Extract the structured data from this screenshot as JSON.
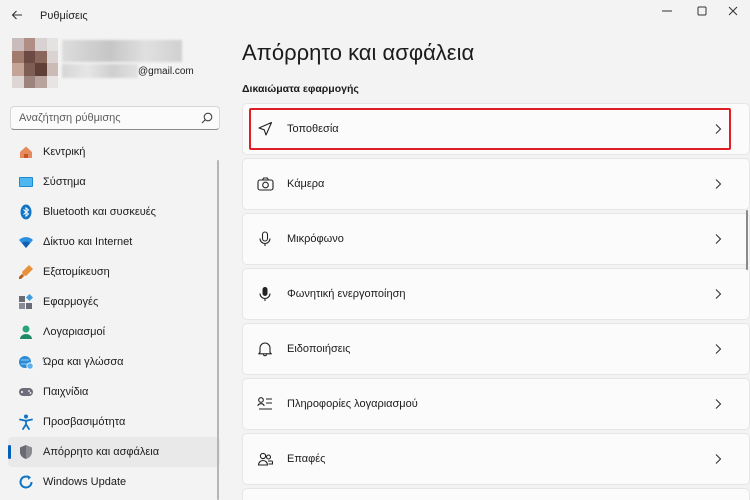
{
  "app": {
    "title": "Ρυθμίσεις"
  },
  "profile": {
    "email_suffix": "@gmail.com"
  },
  "search": {
    "placeholder": "Αναζήτηση ρύθμισης"
  },
  "sidebar": {
    "items": [
      {
        "label": "Κεντρική",
        "icon": "home-icon"
      },
      {
        "label": "Σύστημα",
        "icon": "system-icon"
      },
      {
        "label": "Bluetooth και συσκευές",
        "icon": "bluetooth-icon"
      },
      {
        "label": "Δίκτυο και Internet",
        "icon": "network-icon"
      },
      {
        "label": "Εξατομίκευση",
        "icon": "personalization-icon"
      },
      {
        "label": "Εφαρμογές",
        "icon": "apps-icon"
      },
      {
        "label": "Λογαριασμοί",
        "icon": "accounts-icon"
      },
      {
        "label": "Ώρα και γλώσσα",
        "icon": "time-language-icon"
      },
      {
        "label": "Παιχνίδια",
        "icon": "gaming-icon"
      },
      {
        "label": "Προσβασιμότητα",
        "icon": "accessibility-icon"
      },
      {
        "label": "Απόρρητο και ασφάλεια",
        "icon": "privacy-shield-icon",
        "active": true
      },
      {
        "label": "Windows Update",
        "icon": "windows-update-icon"
      }
    ]
  },
  "main": {
    "title": "Απόρρητο και ασφάλεια",
    "section": "Δικαιώματα εφαρμογής",
    "cards": [
      {
        "label": "Τοποθεσία",
        "icon": "location-icon",
        "highlighted": true
      },
      {
        "label": "Κάμερα",
        "icon": "camera-icon"
      },
      {
        "label": "Μικρόφωνο",
        "icon": "microphone-icon"
      },
      {
        "label": "Φωνητική ενεργοποίηση",
        "icon": "voice-activation-icon"
      },
      {
        "label": "Ειδοποιήσεις",
        "icon": "bell-icon"
      },
      {
        "label": "Πληροφορίες λογαριασμού",
        "icon": "account-info-icon"
      },
      {
        "label": "Επαφές",
        "icon": "contacts-icon"
      }
    ]
  },
  "colors": {
    "accent": "#005fb8",
    "highlight_box": "#e01e28"
  }
}
